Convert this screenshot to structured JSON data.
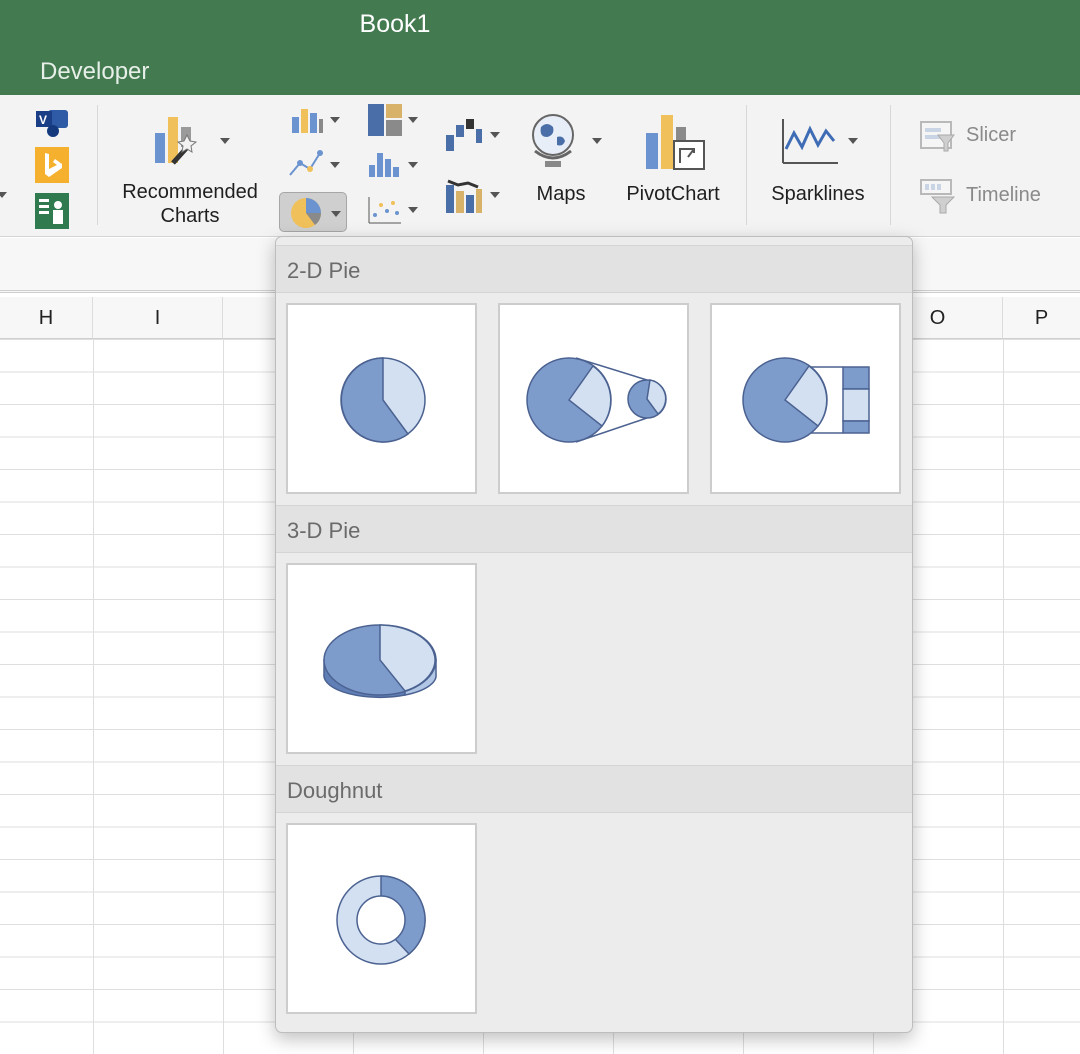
{
  "window": {
    "title": "Book1"
  },
  "tabs": {
    "active": "Developer"
  },
  "ribbon": {
    "recommended_charts": "Recommended\nCharts",
    "recommended_line1": "Recommended",
    "recommended_line2": "Charts",
    "maps": "Maps",
    "pivotchart": "PivotChart",
    "sparklines": "Sparklines",
    "slicer": "Slicer",
    "timeline": "Timeline"
  },
  "columns": [
    "H",
    "I",
    "O",
    "P"
  ],
  "dropdown": {
    "sections": [
      {
        "title": "2-D Pie",
        "items": [
          "pie",
          "pie-of-pie",
          "bar-of-pie"
        ]
      },
      {
        "title": "3-D Pie",
        "items": [
          "3d-pie"
        ]
      },
      {
        "title": "Doughnut",
        "items": [
          "doughnut"
        ]
      }
    ]
  },
  "colors": {
    "title_bar": "#447a50",
    "slice_dark": "#7e9ccb",
    "slice_light": "#d2e0f2",
    "outline": "#4b6291"
  }
}
